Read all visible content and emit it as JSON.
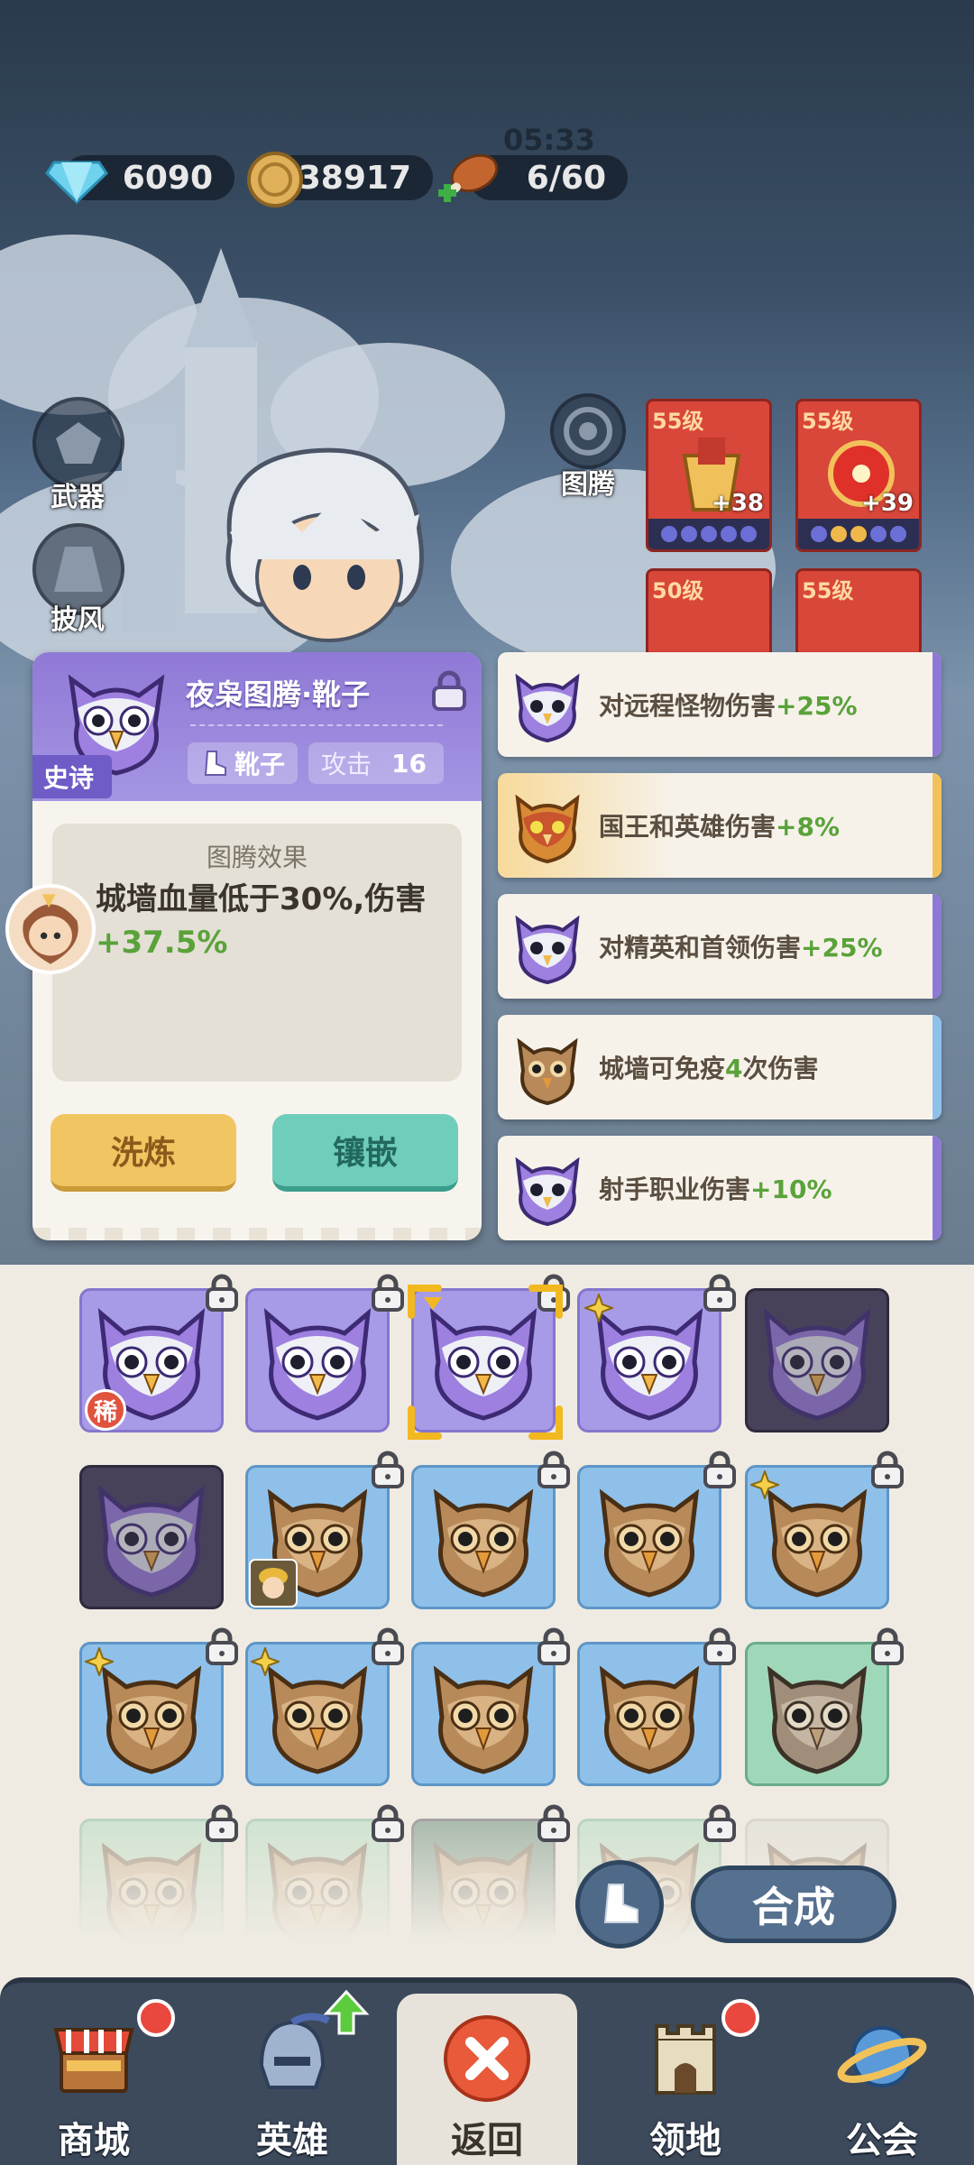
{
  "resources": {
    "gems": "6090",
    "coins": "38917",
    "stamina": "6/60",
    "timer": "05:33"
  },
  "equip_slots": {
    "weapon": "武器",
    "cloak": "披风",
    "totem": "图腾"
  },
  "equip_cards": [
    {
      "level": "55级",
      "plus": "+38"
    },
    {
      "level": "55级",
      "plus": "+39"
    },
    {
      "level": "50级",
      "plus": ""
    },
    {
      "level": "55级",
      "plus": ""
    }
  ],
  "detail": {
    "title": "夜枭图腾·靴子",
    "rarity": "史诗",
    "slot": "靴子",
    "attack_label": "攻击",
    "attack_value": "16",
    "effect_title": "图腾效果",
    "effect_text": "城墙血量低于30%,伤害",
    "effect_value": "+37.5%",
    "refine_button": "洗炼",
    "inlay_button": "镶嵌"
  },
  "effects": [
    {
      "text": "对远程怪物伤害",
      "value": "+25%",
      "tier": "epic"
    },
    {
      "text": "国王和英雄伤害",
      "value": "+8%",
      "tier": "legend"
    },
    {
      "text": "对精英和首领伤害",
      "value": "+25%",
      "tier": "epic"
    },
    {
      "text": "城墙可免疫",
      "value": "4",
      "suffix": "次伤害",
      "tier": "rare"
    },
    {
      "text": "射手职业伤害",
      "value": "+10%",
      "tier": "epic"
    }
  ],
  "grid": {
    "rare_badge": "稀",
    "merge_button": "合成"
  },
  "nav": {
    "shop": "商城",
    "heroes": "英雄",
    "back": "返回",
    "territory": "领地",
    "guild": "公会"
  },
  "colors": {
    "epic": "#a79be8",
    "rare": "#8ec0ea",
    "uncommon": "#9fd8b8",
    "legend": "#f2c25a",
    "value_green": "#5aa23a"
  }
}
